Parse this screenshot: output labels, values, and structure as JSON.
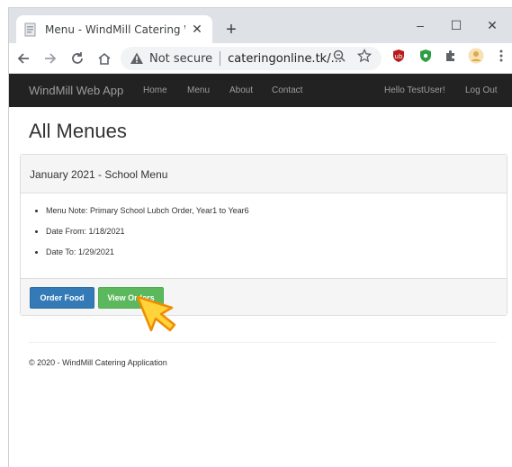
{
  "browser": {
    "tab_title": "Menu - WindMill Catering WebA",
    "close_symbol": "✕",
    "new_tab_symbol": "+",
    "not_secure": "Not secure",
    "url": "cateringonline.tk/...",
    "minimize_symbol": "–",
    "maximize_symbol": "☐",
    "close_window_symbol": "✕"
  },
  "navbar": {
    "brand": "WindMill Web App",
    "links": [
      "Home",
      "Menu",
      "About",
      "Contact"
    ],
    "greeting": "Hello TestUser!",
    "logout": "Log Out"
  },
  "page": {
    "title": "All Menues",
    "panel_title": "January 2021 - School Menu",
    "items": [
      "Menu Note: Primary School Lubch Order, Year1 to Year6",
      "Date From: 1/18/2021",
      "Date To: 1/29/2021"
    ],
    "order_button": "Order Food",
    "view_button": "View Orders",
    "footer": "© 2020 - WindMill Catering Application"
  },
  "colors": {
    "navbar": "#222222",
    "primary": "#337ab7",
    "success": "#5cb85c",
    "cursor": "#f5c518"
  }
}
